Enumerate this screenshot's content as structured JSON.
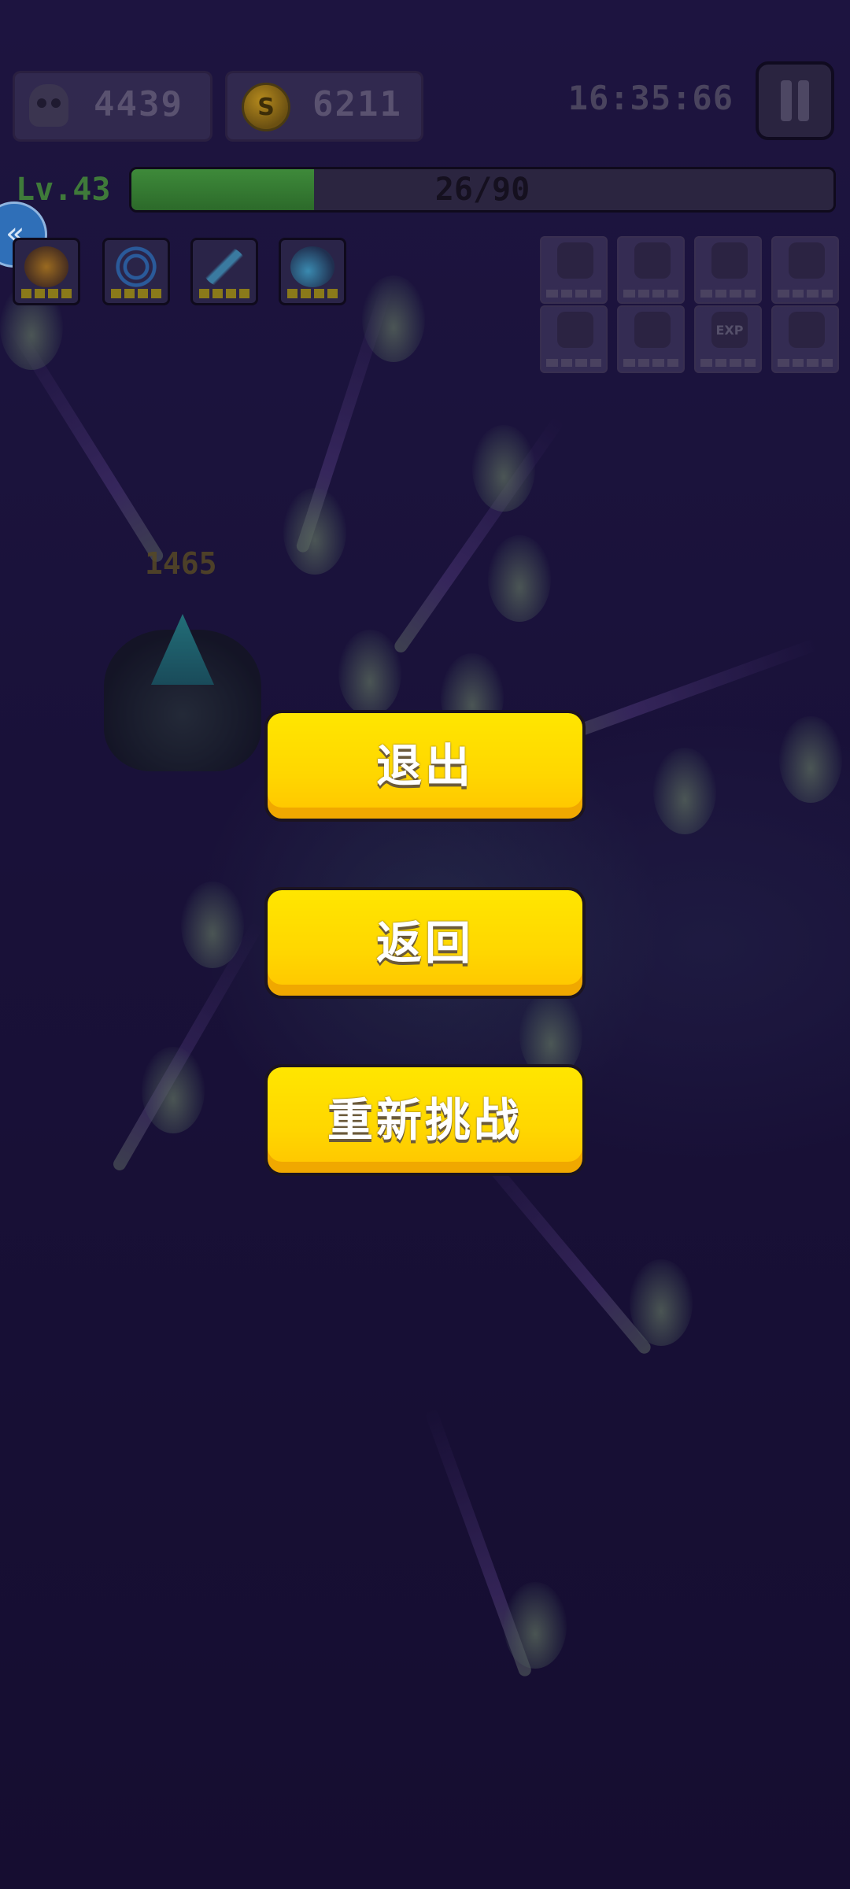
{
  "hud": {
    "kills": "4439",
    "coins": "6211",
    "coin_symbol": "S",
    "timer": "16:35:66",
    "level": "Lv.43",
    "xp_text": "26/90",
    "xp_progress": 0.26
  },
  "damage_text": "1465",
  "side_button": {
    "symbol": "«"
  },
  "skills": [
    "flame-skill",
    "ring-skill",
    "blade-skill",
    "wing-skill"
  ],
  "stats": [
    "strength",
    "heart",
    "boot",
    "shield",
    "magnet",
    "ring",
    "exp",
    "claw"
  ],
  "stat_labels": {
    "exp": "EXP"
  },
  "menu": {
    "exit_label": "退出",
    "back_label": "返回",
    "retry_label": "重新挑战"
  },
  "colors": {
    "button_yellow": "#ffd600",
    "background": "#1a1238",
    "xp_green": "#3e8a3a"
  }
}
